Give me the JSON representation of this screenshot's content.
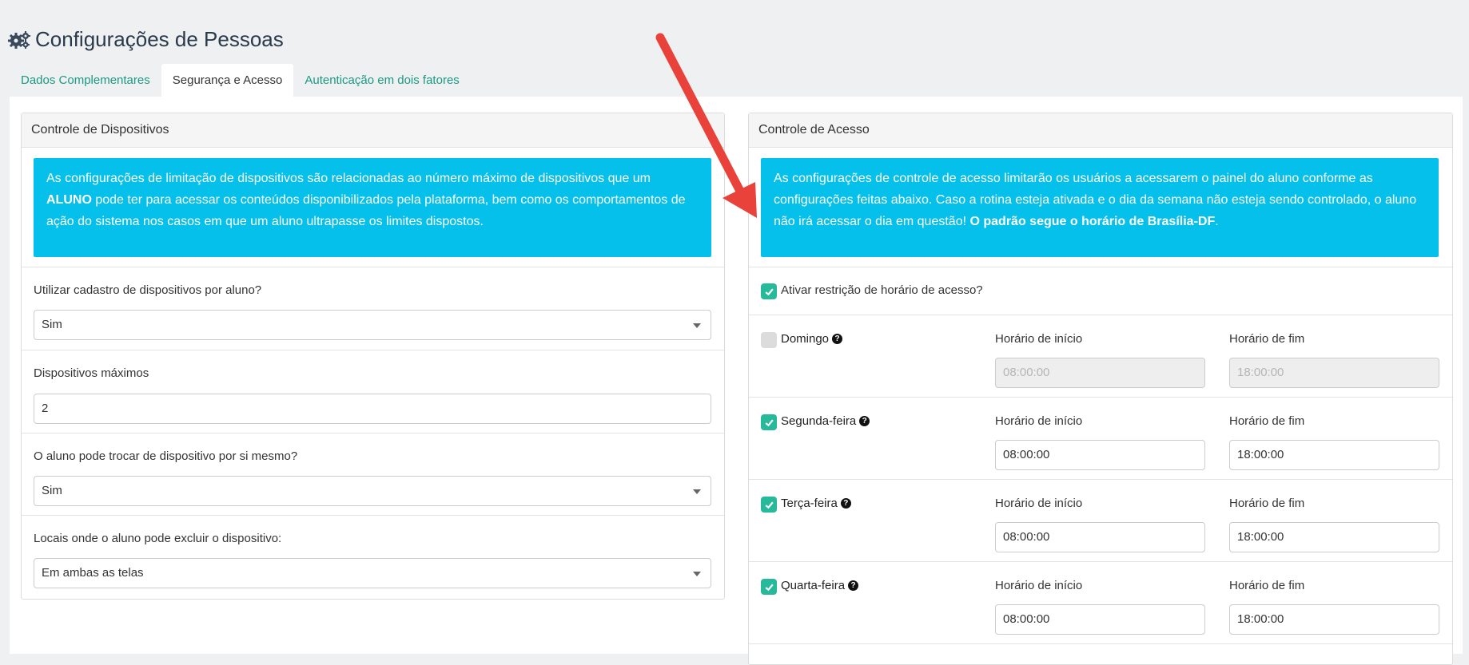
{
  "page": {
    "title": "Configurações de Pessoas",
    "icon": "gears-icon"
  },
  "tabs": [
    {
      "label": "Dados Complementares",
      "active": false
    },
    {
      "label": "Segurança e Acesso",
      "active": true
    },
    {
      "label": "Autenticação em dois fatores",
      "active": false
    }
  ],
  "devices": {
    "heading": "Controle de Dispositivos",
    "alert_part1": "As configurações de limitação de dispositivos são relacionadas ao número máximo de dispositivos que um ",
    "alert_bold": "ALUNO",
    "alert_part2": " pode ter para acessar os conteúdos disponibilizados pela plataforma, bem como os comportamentos de ação do sistema nos casos em que um aluno ultrapasse os limites dispostos.",
    "use_registry_label": "Utilizar cadastro de dispositivos por aluno?",
    "use_registry_value": "Sim",
    "max_devices_label": "Dispositivos máximos",
    "max_devices_value": "2",
    "self_swap_label": "O aluno pode trocar de dispositivo por si mesmo?",
    "self_swap_value": "Sim",
    "delete_places_label": "Locais onde o aluno pode excluir o dispositivo:",
    "delete_places_value": "Em ambas as telas"
  },
  "access": {
    "heading": "Controle de Acesso",
    "alert_part1": "As configurações de controle de acesso limitarão os usuários a acessarem o painel do aluno conforme as configurações feitas abaixo. Caso a rotina esteja ativada e o dia da semana não esteja sendo controlado, o aluno não irá acessar o dia em questão! ",
    "alert_bold": "O padrão segue o horário de Brasília-DF",
    "alert_end": ".",
    "restriction_label": "Ativar restrição de horário de acesso?",
    "restriction_checked": true,
    "start_label": "Horário de início",
    "end_label": "Horário de fim",
    "days": [
      {
        "name": "Domingo",
        "checked": false,
        "start": "08:00:00",
        "end": "18:00:00"
      },
      {
        "name": "Segunda-feira",
        "checked": true,
        "start": "08:00:00",
        "end": "18:00:00"
      },
      {
        "name": "Terça-feira",
        "checked": true,
        "start": "08:00:00",
        "end": "18:00:00"
      },
      {
        "name": "Quarta-feira",
        "checked": true,
        "start": "08:00:00",
        "end": "18:00:00"
      }
    ]
  },
  "colors": {
    "accent": "#26b99a",
    "alert": "#04c0ea",
    "arrow": "#e8423a",
    "tab_link": "#1a9a84"
  }
}
